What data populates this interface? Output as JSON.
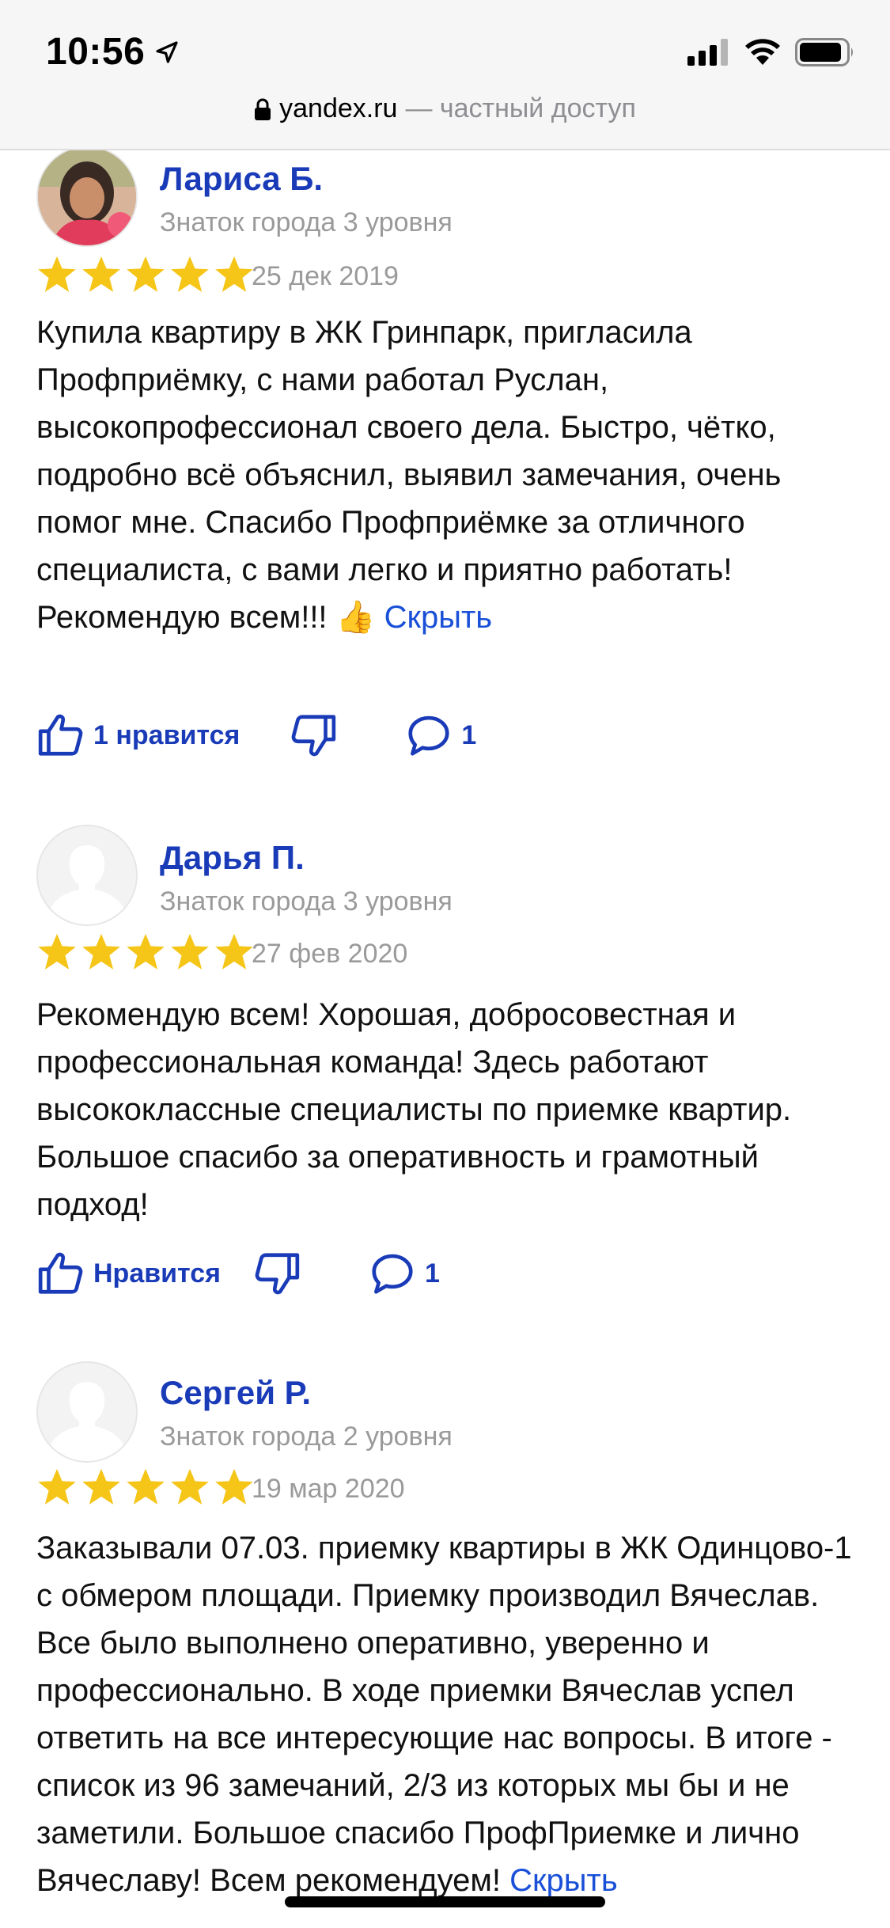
{
  "status_bar": {
    "time": "10:56"
  },
  "browser": {
    "domain": "yandex.ru",
    "suffix": " — частный доступ"
  },
  "reviews": [
    {
      "author": "Лариса Б.",
      "level": "Знаток города 3 уровня",
      "rating": 5,
      "date": "25 дек 2019",
      "text": "Купила квартиру в ЖК Гринпарк, пригласила Профприёмку, с нами работал Руслан, высокопрофессионал своего дела. Быстро, чётко, подробно всё объяснил, выявил замечания, очень помог мне. Спасибо Профприёмке за отличного специалиста, с вами легко и приятно работать! Рекомендую всем!!! 👍",
      "toggle_label": "Скрыть",
      "like_label": "1 нравится",
      "comments": "1"
    },
    {
      "author": "Дарья П.",
      "level": "Знаток города 3 уровня",
      "rating": 5,
      "date": "27 фев 2020",
      "text": "Рекомендую всем! Хорошая, добросовестная и профессиональная команда! Здесь работают высококлассные специалисты по приемке квартир. Большое спасибо за оперативность и грамотный подход!",
      "like_label": "Нравится",
      "comments": "1"
    },
    {
      "author": "Сергей Р.",
      "level": "Знаток города 2 уровня",
      "rating": 5,
      "date": "19 мар 2020",
      "text": "Заказывали 07.03. приемку квартиры в ЖК Одинцово-1 с обмером площади. Приемку производил Вячеслав. Все было выполнено оперативно, уверенно и профессионально. В ходе приемки Вячеслав успел ответить на все интересующие нас вопросы. В итоге - список из 96 замечаний, 2/3 из которых мы бы и не заметили. Большое спасибо ПрофПриемке и лично Вячеславу! Всем рекомендуем!",
      "toggle_label": "Скрыть"
    }
  ],
  "colors": {
    "accent": "#1a3bb8",
    "link": "#1a50d8",
    "star": "#f5c518",
    "muted": "#9a9a9a"
  }
}
